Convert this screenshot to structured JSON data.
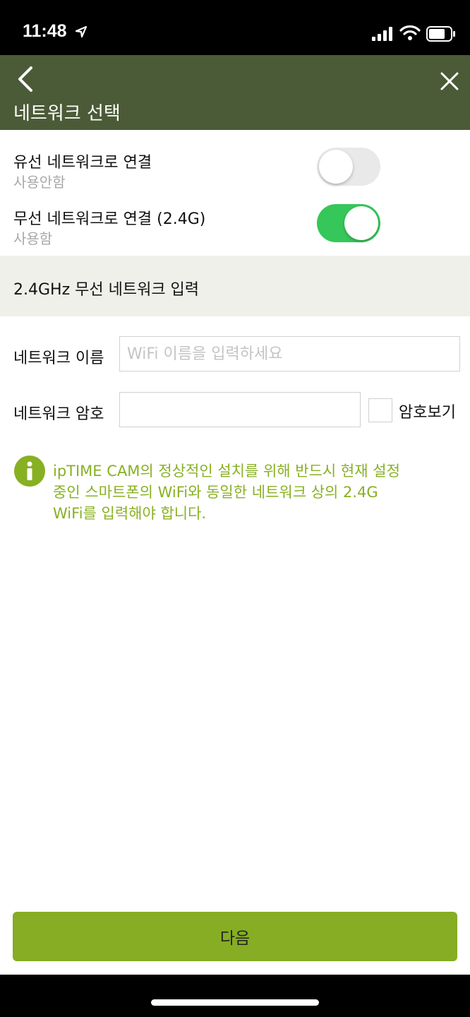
{
  "status_bar": {
    "time": "11:48"
  },
  "nav": {
    "title": "네트워크 선택"
  },
  "wired": {
    "title": "유선 네트워크로 연결",
    "status": "사용안함",
    "enabled": false
  },
  "wireless": {
    "title": "무선 네트워크로 연결 (2.4G)",
    "status": "사용함",
    "enabled": true
  },
  "section": {
    "title": "2.4GHz 무선 네트워크 입력"
  },
  "network_name": {
    "label": "네트워크 이름",
    "value": "",
    "placeholder": "WiFi 이름을 입력하세요"
  },
  "network_password": {
    "label": "네트워크 암호",
    "value": "",
    "show_password_label": "암호보기"
  },
  "info": {
    "lines": [
      "ipTIME CAM의 정상적인 설치를 위해 반드시 현재 설정",
      "중인 스마트폰의 WiFi와 동일한 네트워크 상의 2.4G",
      "WiFi를 입력해야 합니다."
    ],
    "color": "#88b023"
  },
  "footer": {
    "next_label": "다음"
  },
  "colors": {
    "nav_bg": "#4b5b37",
    "accent": "#86ad23",
    "switch_on": "#35c759"
  }
}
